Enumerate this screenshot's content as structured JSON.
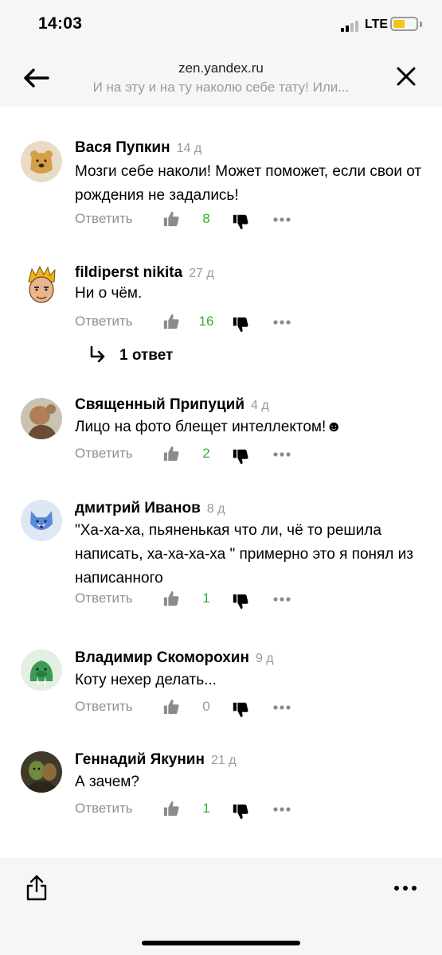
{
  "status_bar": {
    "time": "14:03",
    "network": "LTE"
  },
  "header": {
    "domain": "zen.yandex.ru",
    "subtitle": "И на эту и на ту наколю себе тату! Или..."
  },
  "colors": {
    "positive_count": "#34b12f",
    "neutral_count": "#9a9a9a",
    "battery": "#f3c417"
  },
  "icons": {
    "back": "arrow-left-icon",
    "close": "close-icon",
    "like": "thumbs-up-icon",
    "dislike": "thumbs-down-icon",
    "more": "more-horizontal-icon",
    "share": "share-icon"
  },
  "reply_label": "Ответить",
  "comments": [
    {
      "author": "Вася Пупкин",
      "age": "14 д",
      "text": "Мозги себе наколи! Может поможет, если свои от рождения не задались!",
      "likes": "8"
    },
    {
      "author": "fildiperst nikita",
      "age": "27 д",
      "text": "Ни о чём.",
      "likes": "16",
      "replies_label": "1 ответ"
    },
    {
      "author": "Священный Припуций",
      "age": "4 д",
      "text": "Лицо на фото блещет интеллектом!☻",
      "likes": "2"
    },
    {
      "author": "дмитрий Иванов",
      "age": "8 д",
      "text": "\"Ха-ха-ха, пьяненькая что ли, чё то решила написать, ха-ха-ха-ха \" примерно это я понял из написанного",
      "likes": "1"
    },
    {
      "author": "Владимир Скоморохин",
      "age": "9 д",
      "text": "Коту нехер делать...",
      "likes": "0"
    },
    {
      "author": "Геннадий Якунин",
      "age": "21 д",
      "text": "А зачем?",
      "likes": "1"
    }
  ]
}
